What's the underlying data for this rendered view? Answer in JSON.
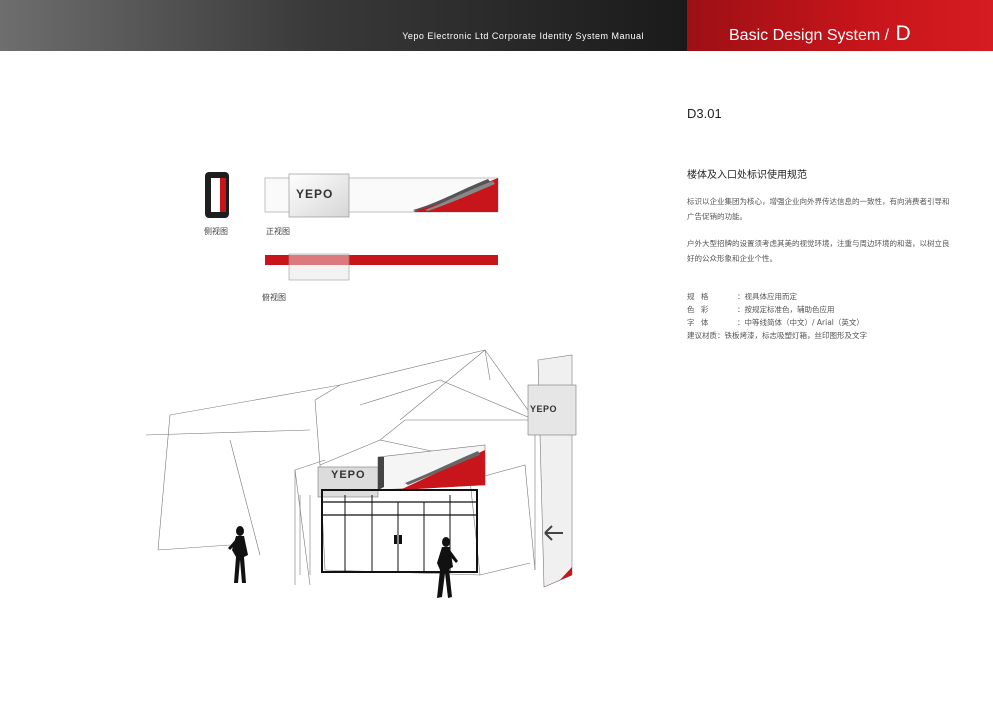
{
  "header": {
    "manual_title": "Yepo Electronic Ltd Corporate Identity System Manual",
    "section_title": "Basic Design System",
    "section_slash": "/",
    "section_letter": "D"
  },
  "content": {
    "code": "D3.01",
    "subtitle": "楼体及入口处标识使用规范",
    "paragraph1": "标识以企业集团为核心，增强企业向外界传达信息的一致性，有向消费者引导和广告促销的功能。",
    "paragraph2": "户外大型招牌的设置须考虑其美的视觉环境，注重与周边环境的和谐，以树立良好的公众形象和企业个性。",
    "specs": [
      {
        "label": "规 格",
        "value": "：视具体应用而定"
      },
      {
        "label": "色 彩",
        "value": "：按规定标准色，辅助色应用"
      },
      {
        "label": "字 体",
        "value": "：中等线简体（中文）/ Arial（英文）"
      },
      {
        "label": "建议材质",
        "value": "：铁板烤漆，标志吸塑灯箱，丝印图形及文字"
      }
    ]
  },
  "views": {
    "side": "侧视图",
    "front": "正视图",
    "top": "俯视图"
  },
  "logo_text": "YEPO",
  "colors": {
    "brand_red": "#c8151b",
    "dark_gray": "#3a3a3a"
  }
}
